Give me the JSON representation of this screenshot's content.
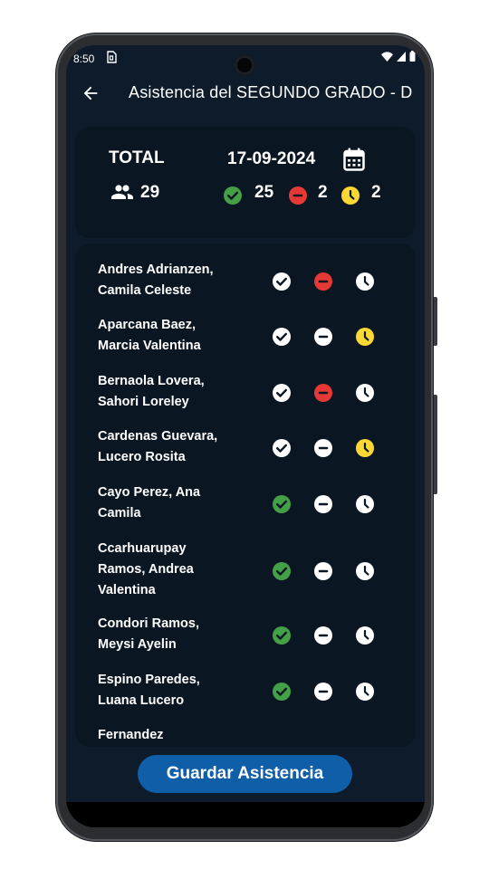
{
  "status_bar": {
    "time": "8:50"
  },
  "app_bar": {
    "title": "Asistencia del SEGUNDO GRADO - D"
  },
  "summary": {
    "total_label": "TOTAL",
    "date": "17-09-2024",
    "total_students": "29",
    "present_count": "25",
    "absent_count": "2",
    "late_count": "2"
  },
  "colors": {
    "present": "#43a047",
    "absent": "#e53935",
    "late": "#fdd835",
    "inactive": "#ffffff",
    "button": "#0f5ea8"
  },
  "students": [
    {
      "name": "Andres Adrianzen, Camila Celeste",
      "status": "absent"
    },
    {
      "name": "Aparcana Baez, Marcia Valentina",
      "status": "late"
    },
    {
      "name": "Bernaola Lovera, Sahori Loreley",
      "status": "absent"
    },
    {
      "name": "Cardenas Guevara, Lucero Rosita",
      "status": "late"
    },
    {
      "name": "Cayo Perez, Ana Camila",
      "status": "present"
    },
    {
      "name": "Ccarhuarupay Ramos, Andrea Valentina",
      "status": "present"
    },
    {
      "name": "Condori Ramos, Meysi Ayelin",
      "status": "present"
    },
    {
      "name": "Espino Paredes, Luana Lucero",
      "status": "present"
    },
    {
      "name": "Fernandez",
      "status": "none"
    }
  ],
  "save_button": {
    "label": "Guardar Asistencia"
  },
  "icons": {
    "back": "arrow-back-icon",
    "calendar": "calendar-icon",
    "students": "people-icon",
    "present": "check-circle-icon",
    "absent": "minus-circle-icon",
    "late": "clock-icon"
  }
}
